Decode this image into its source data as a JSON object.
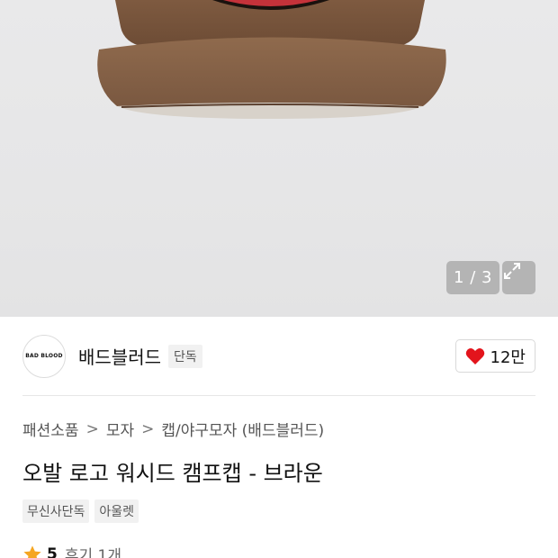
{
  "gallery": {
    "counter": "1 / 3",
    "expand_icon": "expand-icon"
  },
  "brand": {
    "logo_text": "BAD BLOOD",
    "name": "배드블러드",
    "exclusive_badge": "단독"
  },
  "like": {
    "icon": "heart-icon",
    "color": "#e3141c",
    "count": "12만"
  },
  "breadcrumb": {
    "items": [
      "패션소품",
      "모자",
      "캡/야구모자 (배드블러드)"
    ],
    "separator": ">"
  },
  "product": {
    "title": "오발 로고 워시드 캠프캡 - 브라운",
    "tags": [
      "무신사단독",
      "아울렛"
    ]
  },
  "rating": {
    "icon": "star-icon",
    "star_color": "#f5a623",
    "score": "5",
    "reviews": "후기 1개"
  },
  "colors": {
    "cap_brown": "#8a6244",
    "logo_red": "#c4323a"
  }
}
